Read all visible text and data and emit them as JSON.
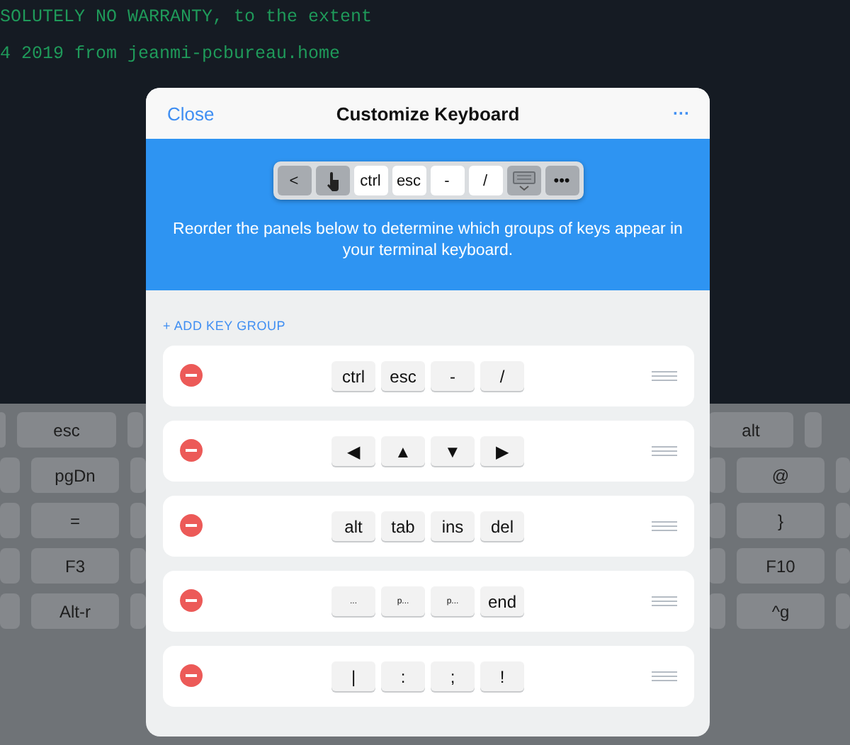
{
  "terminal": {
    "lines": [
      "SOLUTELY NO WARRANTY, to the extent",
      "4 2019 from jeanmi-pcbureau.home"
    ]
  },
  "keyboard": {
    "left_keys": [
      "esc",
      "pgDn",
      "=",
      "F3",
      "Alt-r"
    ],
    "right_keys": [
      "alt",
      "@",
      "}",
      "F10",
      "^g"
    ]
  },
  "dialog": {
    "close": "Close",
    "title": "Customize Keyboard",
    "more": "···",
    "preview_keys": [
      {
        "kind": "symbol",
        "label": "<"
      },
      {
        "kind": "gesture"
      },
      {
        "kind": "key",
        "label": "ctrl"
      },
      {
        "kind": "key",
        "label": "esc"
      },
      {
        "kind": "key",
        "label": "-"
      },
      {
        "kind": "key",
        "label": "/"
      },
      {
        "kind": "dismiss"
      },
      {
        "kind": "symbol",
        "label": "•••"
      }
    ],
    "description": "Reorder the panels below to determine which groups of keys appear in your terminal keyboard.",
    "add_group": "+ ADD KEY GROUP",
    "groups": [
      {
        "keys": [
          "ctrl",
          "esc",
          "-",
          "/"
        ]
      },
      {
        "keys": [
          "◀",
          "▲",
          "▼",
          "▶"
        ]
      },
      {
        "keys": [
          "alt",
          "tab",
          "ins",
          "del"
        ]
      },
      {
        "keys": [
          "...",
          "p...",
          "p...",
          "end"
        ]
      },
      {
        "keys": [
          "|",
          ":",
          ";",
          "!"
        ]
      }
    ]
  }
}
